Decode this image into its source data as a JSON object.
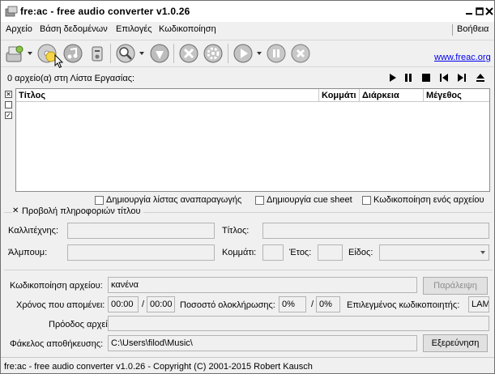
{
  "window": {
    "title": "fre:ac - free audio converter v1.0.26"
  },
  "menu": {
    "items": [
      "Αρχείο",
      "Βάση δεδομένων",
      "Επιλογές",
      "Κωδικοποίηση"
    ],
    "help": "Βοήθεια"
  },
  "toolbar": {
    "link": "www.freac.org",
    "icons": [
      "add-files-icon",
      "add-folder-icon",
      "cd-icon",
      "remove-icon",
      "search-icon",
      "clock-icon",
      "tools-icon",
      "gear-icon",
      "play-icon",
      "pause-icon",
      "stop-icon"
    ]
  },
  "joblist": {
    "count_label": "0 αρχείο(α) στη Λίστα Εργασίας:",
    "columns": [
      "Τίτλος",
      "Κομμάτι",
      "Διάρκεια",
      "Μέγεθος"
    ]
  },
  "options": {
    "playlist": "Δημιουργία λίστας αναπαραγωγής",
    "cuesheet": "Δημιουργία cue sheet",
    "single_file": "Κωδικοποίηση ενός αρχείου"
  },
  "title_info": {
    "toggle_label": "Προβολή πληροφοριών τίτλου",
    "artist_label": "Καλλιτέχνης:",
    "title_label": "Τίτλος:",
    "album_label": "Άλμπουμ:",
    "track_label": "Κομμάτι:",
    "year_label": "Έτος:",
    "genre_label": "Είδος:"
  },
  "encoding": {
    "file_label": "Κωδικοποίηση αρχείου:",
    "file_value": "κανένα",
    "skip_button": "Παράλειψη",
    "time_left_label": "Χρόνος που απομένει:",
    "time_left_value": "00:00",
    "time_total_value": "00:00",
    "slash": "/",
    "percent_label": "Ποσοστό ολοκλήρωσης:",
    "percent_value": "0%",
    "percent_total": "0%",
    "encoder_label": "Επιλεγμένος κωδικοποιητής:",
    "encoder_value": "LAM",
    "progress_label": "Πρόοδος αρχείου:",
    "folder_label": "Φάκελος αποθήκευσης:",
    "folder_value": "C:\\Users\\filod\\Music\\",
    "browse_button": "Εξερεύνηση"
  },
  "status": {
    "text": "fre:ac - free audio converter v1.0.26 - Copyright (C) 2001-2015 Robert Kausch"
  }
}
